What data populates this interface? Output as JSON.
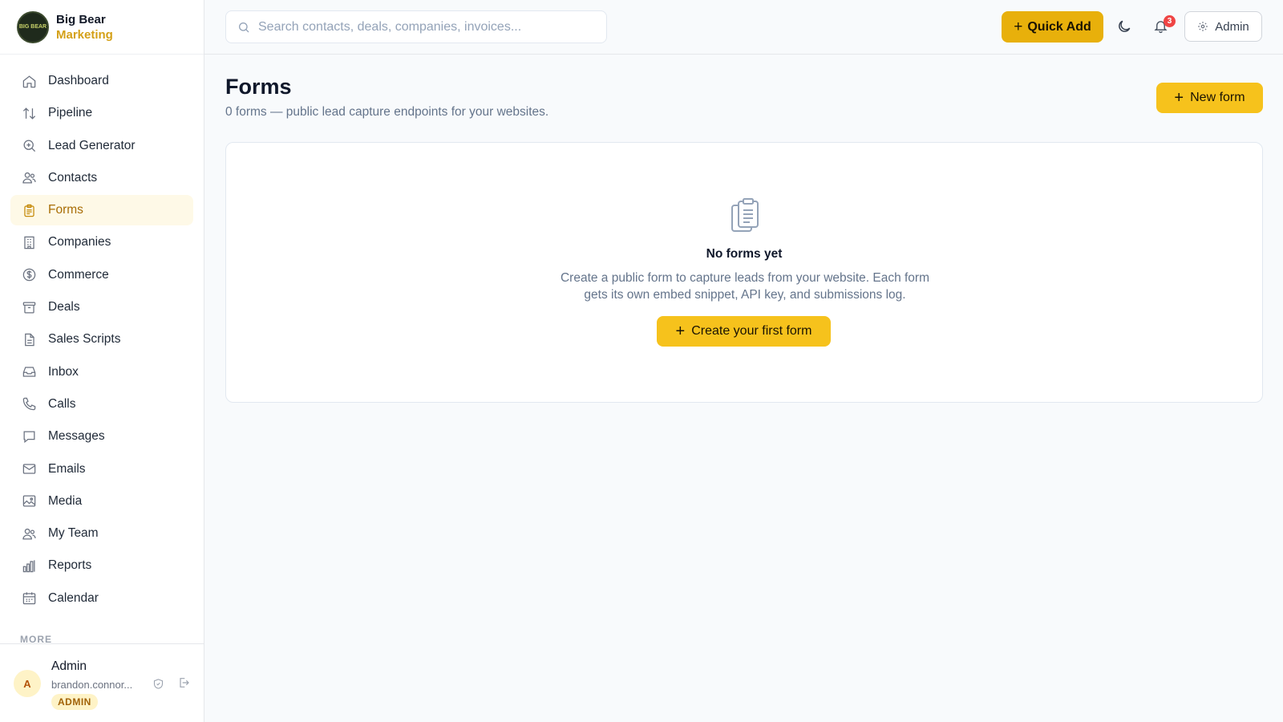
{
  "brand": {
    "name": "Big Bear",
    "sub": "Marketing",
    "logo_text": "BIG BEAR"
  },
  "sidebar": {
    "items": [
      {
        "label": "Dashboard",
        "icon": "home-icon"
      },
      {
        "label": "Pipeline",
        "icon": "arrows-up-down-icon"
      },
      {
        "label": "Lead Generator",
        "icon": "search-plus-icon"
      },
      {
        "label": "Contacts",
        "icon": "users-icon"
      },
      {
        "label": "Forms",
        "icon": "clipboard-icon",
        "active": true
      },
      {
        "label": "Companies",
        "icon": "building-icon"
      },
      {
        "label": "Commerce",
        "icon": "dollar-circle-icon"
      },
      {
        "label": "Deals",
        "icon": "archive-box-icon"
      },
      {
        "label": "Sales Scripts",
        "icon": "document-icon"
      },
      {
        "label": "Inbox",
        "icon": "inbox-icon"
      },
      {
        "label": "Calls",
        "icon": "phone-icon"
      },
      {
        "label": "Messages",
        "icon": "chat-bubble-icon"
      },
      {
        "label": "Emails",
        "icon": "envelope-icon"
      },
      {
        "label": "Media",
        "icon": "image-icon"
      },
      {
        "label": "My Team",
        "icon": "team-icon"
      },
      {
        "label": "Reports",
        "icon": "bar-chart-icon"
      },
      {
        "label": "Calendar",
        "icon": "calendar-icon"
      }
    ],
    "more_label": "MORE"
  },
  "user": {
    "initial": "A",
    "name": "Admin",
    "email": "brandon.connor...",
    "role": "ADMIN"
  },
  "topbar": {
    "search_placeholder": "Search contacts, deals, companies, invoices...",
    "quick_add": "Quick Add",
    "notifications_count": "3",
    "admin_label": "Admin"
  },
  "main": {
    "title": "Forms",
    "subtitle": "0 forms — public lead capture endpoints for your websites.",
    "new_form": "New form",
    "empty": {
      "title": "No forms yet",
      "description": "Create a public form to capture leads from your website. Each form gets its own embed snippet, API key, and submissions log.",
      "button": "Create your first form"
    }
  },
  "colors": {
    "accent": "#f6c21c",
    "quick_add": "#e8b00b",
    "active_bg": "#fef9e7",
    "active_text": "#a86d05",
    "badge": "#ef4444"
  }
}
